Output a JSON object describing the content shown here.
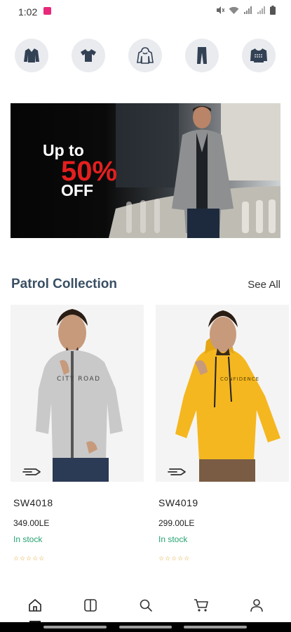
{
  "status_bar": {
    "time": "1:02"
  },
  "categories": [
    {
      "icon": "jacket-icon"
    },
    {
      "icon": "tshirt-icon"
    },
    {
      "icon": "hoodie-icon"
    },
    {
      "icon": "pants-icon"
    },
    {
      "icon": "sweater-icon"
    }
  ],
  "banner": {
    "line1": "Up to",
    "percent": "50%",
    "off": "OFF"
  },
  "section": {
    "title": "Patrol Collection",
    "see_all": "See All"
  },
  "products": [
    {
      "name": "SW4018",
      "price": "349.00LE",
      "stock": "In stock",
      "stars": "☆☆☆☆☆",
      "color": "#c9c9c9",
      "print": "CITY ROAD"
    },
    {
      "name": "SW4019",
      "price": "299.00LE",
      "stock": "In stock",
      "stars": "☆☆☆☆☆",
      "color": "#f5b71f",
      "print": "CONFIDENCE"
    }
  ],
  "nav": [
    {
      "icon": "home-icon"
    },
    {
      "icon": "catalog-icon"
    },
    {
      "icon": "search-icon"
    },
    {
      "icon": "cart-icon"
    },
    {
      "icon": "profile-icon"
    }
  ]
}
